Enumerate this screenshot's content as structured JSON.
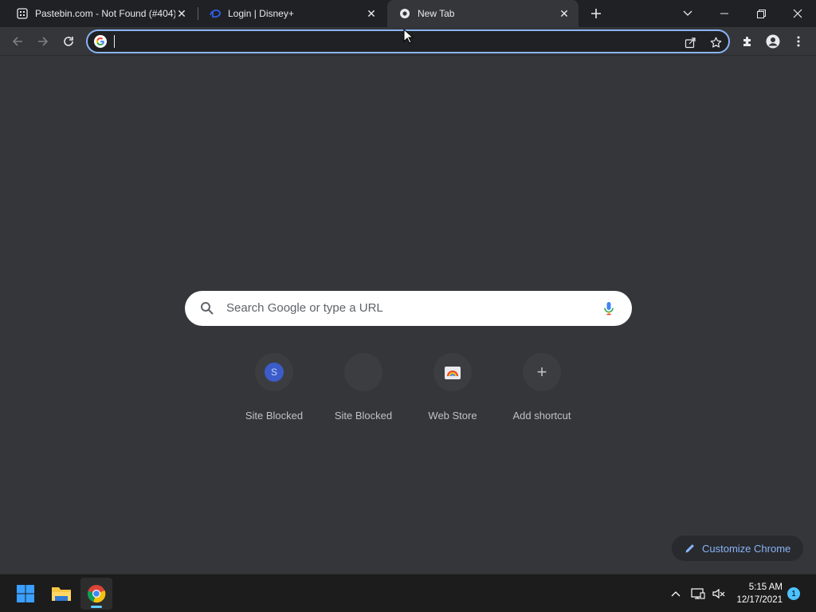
{
  "tabs": [
    {
      "title": "Pastebin.com - Not Found (#404)",
      "favicon": "pastebin-icon"
    },
    {
      "title": "Login | Disney+",
      "favicon": "disney-plus-icon"
    },
    {
      "title": "New Tab",
      "favicon": "chrome-icon",
      "active": true
    }
  ],
  "omnibox": {
    "value": "",
    "placeholder": ""
  },
  "ntp": {
    "search_placeholder": "Search Google or type a URL",
    "shortcuts": [
      {
        "label": "Site Blocked",
        "icon": "letter-s-icon",
        "letter": "S"
      },
      {
        "label": "Site Blocked",
        "icon": "blank-site-icon",
        "letter": ""
      },
      {
        "label": "Web Store",
        "icon": "web-store-icon",
        "letter": ""
      },
      {
        "label": "Add shortcut",
        "icon": "plus-icon",
        "letter": "+"
      }
    ],
    "customize_label": "Customize Chrome"
  },
  "taskbar": {
    "time": "5:15 AM",
    "date": "12/17/2021",
    "notification_count": "1",
    "apps": [
      "windows-start-icon",
      "file-explorer-icon",
      "chrome-icon"
    ]
  },
  "colors": {
    "accent": "#8ab4f8",
    "background": "#35363a",
    "tabstrip": "#202124",
    "taskbar": "#1c1c1c"
  }
}
